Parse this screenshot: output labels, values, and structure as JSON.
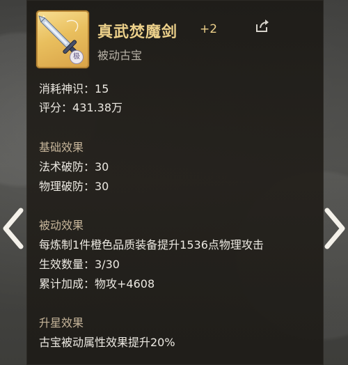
{
  "item": {
    "name": "真武焚魔剑",
    "level": "+2",
    "type": "被动古宝",
    "badge": "极",
    "corner_mark": "✦"
  },
  "stats": {
    "consume_label": "消耗神识：",
    "consume_value": "15",
    "score_label": "评分：",
    "score_value": "431.38万"
  },
  "base_effect": {
    "heading": "基础效果",
    "lines": [
      "法术破防：30",
      "物理破防：30"
    ]
  },
  "passive_effect": {
    "heading": "被动效果",
    "lines": [
      "每炼制1件橙色品质装备提升1536点物理攻击",
      "生效数量：3/30",
      "累计加成：物攻+4608"
    ]
  },
  "star_effect": {
    "heading": "升星效果",
    "lines": [
      "古宝被动属性效果提升20%"
    ]
  },
  "icons": {
    "share": "share-icon",
    "prev": "arrow-left-icon",
    "next": "arrow-right-icon",
    "item": "sword-icon"
  },
  "colors": {
    "title_gold": "#ecd08a",
    "heading_tan": "#c6b59a",
    "text_white": "#ece9e2",
    "frame_gold": "#e9bf5e"
  }
}
